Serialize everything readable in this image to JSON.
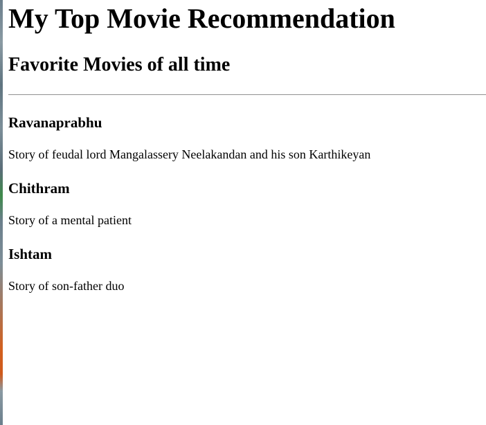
{
  "header": {
    "title": "My Top Movie Recommendation",
    "subtitle": "Favorite Movies of all time"
  },
  "movies": [
    {
      "title": "Ravanaprabhu",
      "description": "Story of feudal lord Mangalassery Neelakandan and his son Karthikeyan"
    },
    {
      "title": "Chithram",
      "description": "Story of a mental patient"
    },
    {
      "title": "Ishtam",
      "description": "Story of son-father duo"
    }
  ]
}
